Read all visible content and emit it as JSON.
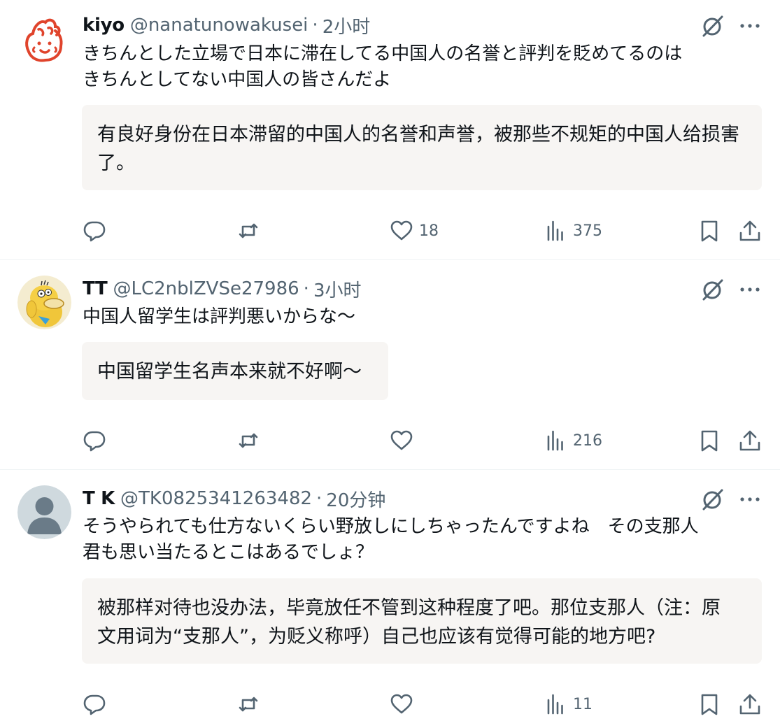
{
  "tweets": [
    {
      "name": "kiyo",
      "handle": "@nanatunowakusei",
      "separator": "·",
      "time": "2小时",
      "text": "きちんとした立場で日本に滞在してる中国人の名誉と評判を貶めてるのは\nきちんとしてない中国人の皆さんだよ",
      "translation": "有良好身份在日本滞留的中国人的名誉和声誉，被那些不规矩的中国人给损害了。",
      "stats": {
        "replies": "",
        "reposts": "",
        "likes": "18",
        "views": "375"
      }
    },
    {
      "name": "TT",
      "handle": "@LC2nblZVSe27986",
      "separator": "·",
      "time": "3小时",
      "text": "中国人留学生は評判悪いからな～",
      "translation": "中国留学生名声本来就不好啊～",
      "stats": {
        "replies": "",
        "reposts": "",
        "likes": "",
        "views": "216"
      }
    },
    {
      "name": "T K",
      "handle": "@TK0825341263482",
      "separator": "·",
      "time": "20分钟",
      "text": "そうやられても仕方ないくらい野放しにしちゃったんですよね　その支那人\n君も思い当たるとこはあるでしょ？",
      "translation": "被那样对待也没办法，毕竟放任不管到这种程度了吧。那位支那人（注：原\n文用词为“支那人”，为贬义称呼）自己也应该有觉得可能的地方吧?",
      "stats": {
        "replies": "",
        "reposts": "",
        "likes": "",
        "views": "11"
      }
    }
  ],
  "icons": {
    "grok": "grok-icon",
    "more": "more-icon",
    "reply": "reply-icon",
    "repost": "repost-icon",
    "like": "like-icon",
    "views": "views-icon",
    "bookmark": "bookmark-icon",
    "share": "share-icon"
  },
  "colors": {
    "text": "#0f1419",
    "secondary": "#536471",
    "translation_bg": "#f7f5f3",
    "divider": "#eff3f4"
  }
}
